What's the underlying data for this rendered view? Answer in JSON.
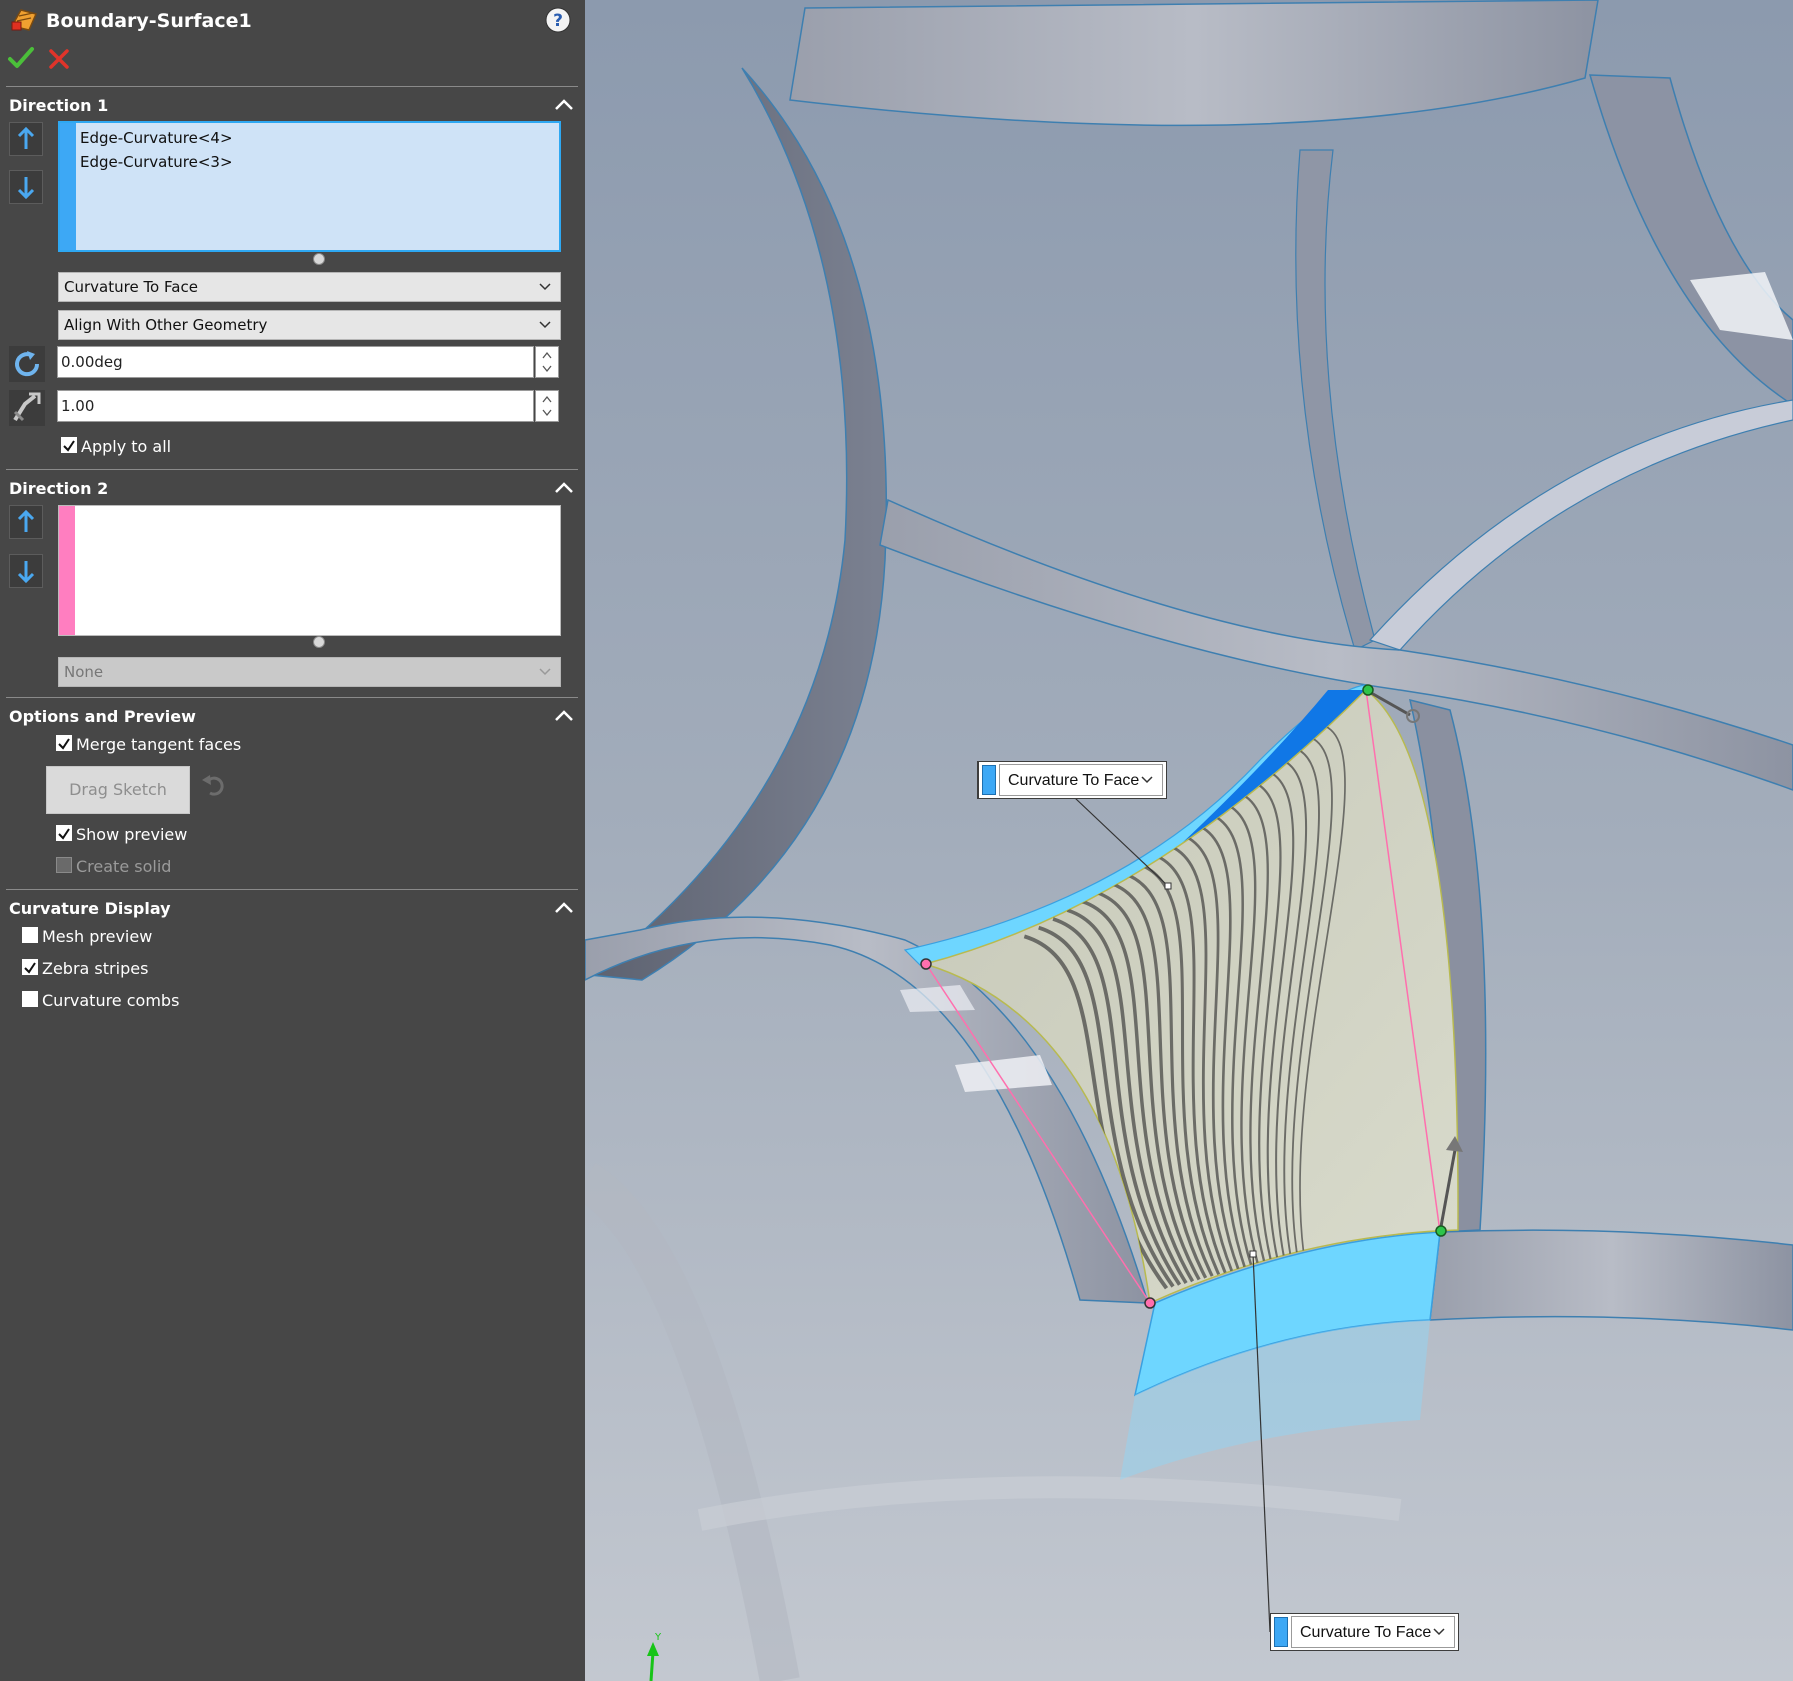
{
  "window": {
    "title": "Boundary-Surface1",
    "help_icon": "question-icon",
    "ok_icon": "checkmark-icon",
    "cancel_icon": "x-icon"
  },
  "direction1": {
    "title": "Direction 1",
    "items": [
      "Edge-Curvature<4>",
      "Edge-Curvature<3>"
    ],
    "condition": "Curvature To Face",
    "alignment": "Align With Other Geometry",
    "draft_angle": "0.00deg",
    "tangent_influence": "1.00",
    "apply_to_all": "Apply to all",
    "apply_to_all_checked": true,
    "strip_color": "#3da8f5"
  },
  "direction2": {
    "title": "Direction 2",
    "items": [],
    "condition": "None",
    "strip_color": "#ff7ec0"
  },
  "options": {
    "title": "Options and Preview",
    "merge_tangent_faces": "Merge tangent faces",
    "merge_tangent_faces_checked": true,
    "drag_sketch": "Drag Sketch",
    "show_preview": "Show preview",
    "show_preview_checked": true,
    "create_solid": "Create solid",
    "create_solid_checked": false
  },
  "curvature_display": {
    "title": "Curvature Display",
    "mesh_preview": "Mesh preview",
    "mesh_preview_checked": false,
    "zebra_stripes": "Zebra stripes",
    "zebra_stripes_checked": true,
    "curvature_combs": "Curvature combs",
    "curvature_combs_checked": false
  },
  "viewport": {
    "callout_top": "Curvature To Face",
    "callout_bottom": "Curvature To Face",
    "triad_axis": "Y",
    "selection_color": "#6ed6ff",
    "highlight_color": "#1077e6"
  }
}
